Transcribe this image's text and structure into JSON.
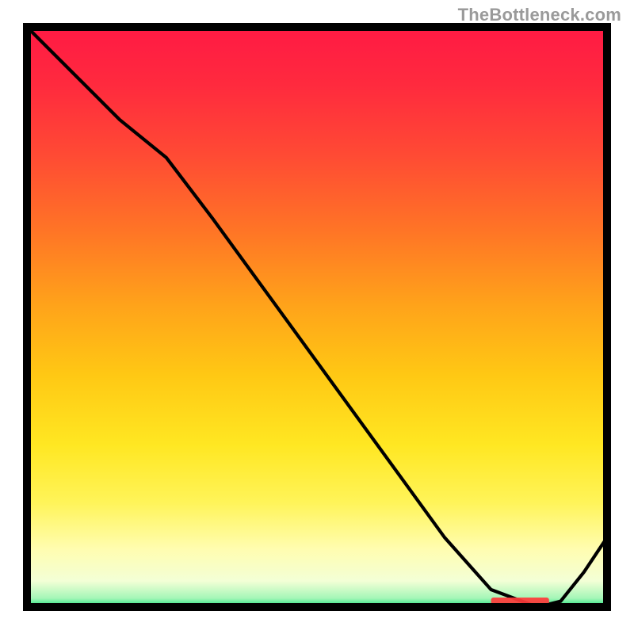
{
  "watermark": "TheBottleneck.com",
  "chart_data": {
    "type": "line",
    "title": "",
    "xlabel": "",
    "ylabel": "",
    "xlim": [
      0,
      100
    ],
    "ylim": [
      0,
      100
    ],
    "grid": false,
    "series": [
      {
        "name": "curve",
        "x": [
          0,
          8,
          16,
          24,
          32,
          40,
          48,
          56,
          64,
          72,
          80,
          88,
          92,
          96,
          100
        ],
        "values": [
          100,
          92,
          84,
          77.5,
          67,
          56,
          45,
          34,
          23,
          12,
          3,
          0,
          1,
          6,
          12
        ]
      }
    ],
    "marker": {
      "label": "",
      "x_start": 80,
      "x_end": 90
    },
    "gradient_stops": [
      {
        "offset": 0.0,
        "color": "#ff1a44"
      },
      {
        "offset": 0.1,
        "color": "#ff2a3e"
      },
      {
        "offset": 0.22,
        "color": "#ff4a34"
      },
      {
        "offset": 0.35,
        "color": "#ff7426"
      },
      {
        "offset": 0.48,
        "color": "#ffa31a"
      },
      {
        "offset": 0.6,
        "color": "#ffc814"
      },
      {
        "offset": 0.72,
        "color": "#ffe722"
      },
      {
        "offset": 0.82,
        "color": "#fff459"
      },
      {
        "offset": 0.9,
        "color": "#fffdb0"
      },
      {
        "offset": 0.955,
        "color": "#f3ffd6"
      },
      {
        "offset": 0.985,
        "color": "#a4f6b7"
      },
      {
        "offset": 1.0,
        "color": "#18e07a"
      }
    ]
  }
}
